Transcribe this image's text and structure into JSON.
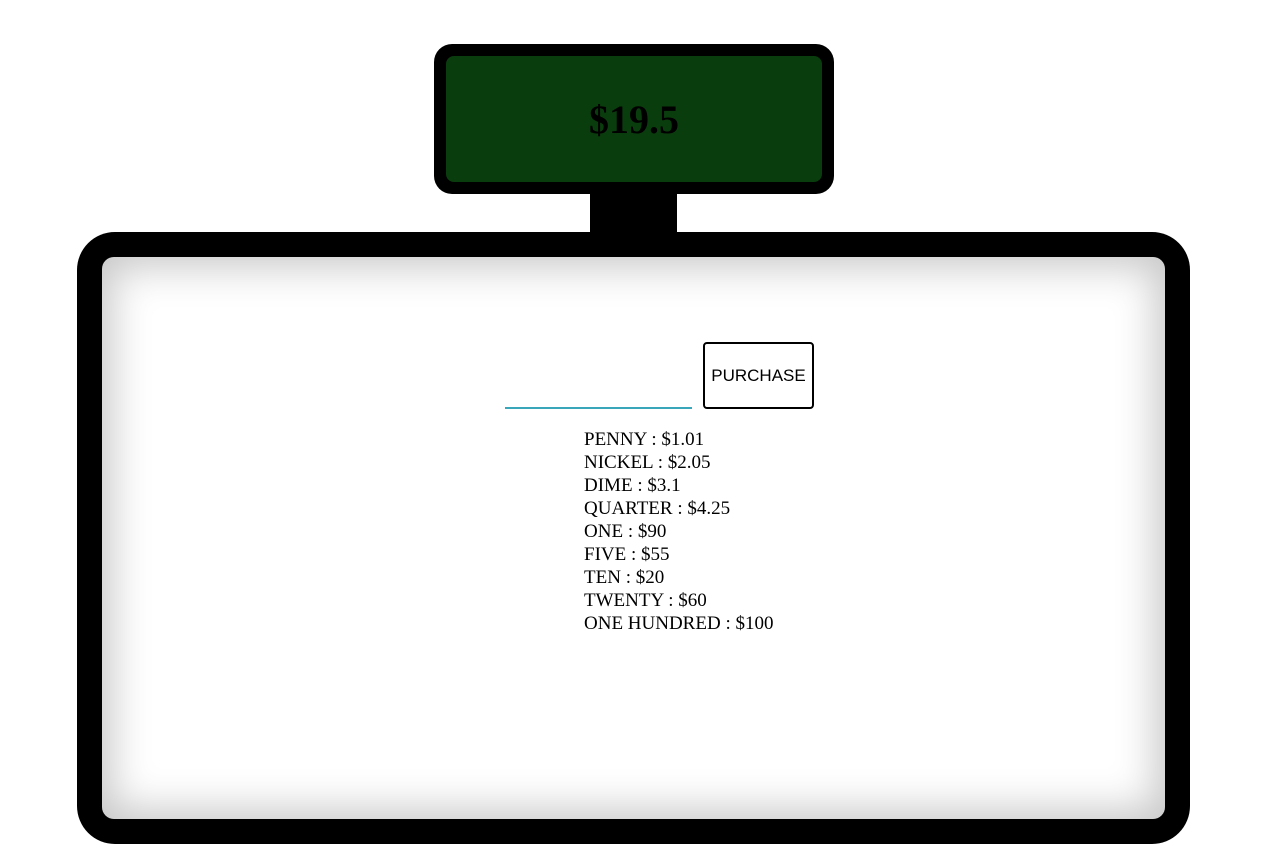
{
  "display": {
    "price": "$19.5"
  },
  "register": {
    "input": {
      "value": "",
      "placeholder": ""
    },
    "purchase_label": "PURCHASE",
    "cash_in_drawer": [
      {
        "name": "PENNY",
        "amount": "$1.01"
      },
      {
        "name": "NICKEL",
        "amount": "$2.05"
      },
      {
        "name": "DIME",
        "amount": "$3.1"
      },
      {
        "name": "QUARTER",
        "amount": "$4.25"
      },
      {
        "name": "ONE",
        "amount": "$90"
      },
      {
        "name": "FIVE",
        "amount": "$55"
      },
      {
        "name": "TEN",
        "amount": "$20"
      },
      {
        "name": "TWENTY",
        "amount": "$60"
      },
      {
        "name": "ONE HUNDRED",
        "amount": "$100"
      }
    ]
  },
  "colors": {
    "display_background": "#0a3d0d",
    "frame": "#000000",
    "input_underline": "#3aa6b9"
  }
}
